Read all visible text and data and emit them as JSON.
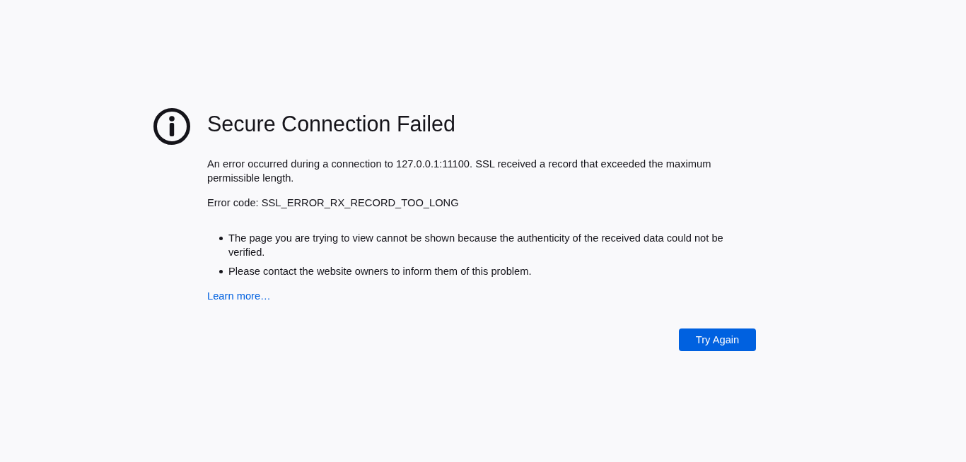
{
  "error_page": {
    "title": "Secure Connection Failed",
    "description": "An error occurred during a connection to 127.0.0.1:11100. SSL received a record that exceeded the maximum permissible length.",
    "error_code": "Error code: SSL_ERROR_RX_RECORD_TOO_LONG",
    "advice": [
      "The page you are trying to view cannot be shown because the authenticity of the received data could not be verified.",
      "Please contact the website owners to inform them of this problem."
    ],
    "learn_more_link": "Learn more…",
    "buttons": [
      {
        "label": "Try Again"
      }
    ]
  }
}
